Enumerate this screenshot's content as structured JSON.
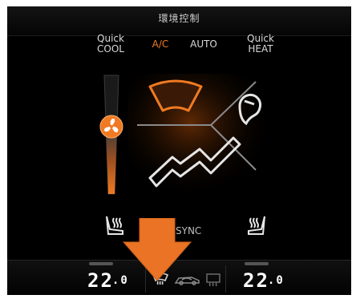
{
  "header": {
    "title": "環境控制"
  },
  "modes": {
    "quick_cool": "Quick\nCOOL",
    "ac": "A/C",
    "auto": "AUTO",
    "quick_heat": "Quick\nHEAT"
  },
  "sync_label": "SYNC",
  "bottom": {
    "left_temp_int": "22",
    "left_temp_dec": ".0",
    "right_temp_int": "22",
    "right_temp_dec": ".0"
  },
  "colors": {
    "accent": "#f07a22",
    "background": "#000000",
    "text": "#d9d9d9"
  },
  "icons": [
    "fan-icon",
    "windshield-airflow-icon",
    "body-airflow-icon",
    "face-airflow-icon",
    "left-seat-heat-icon",
    "right-seat-heat-icon",
    "front-defrost-icon",
    "recirculation-icon",
    "rear-defrost-icon",
    "down-arrow-icon"
  ]
}
